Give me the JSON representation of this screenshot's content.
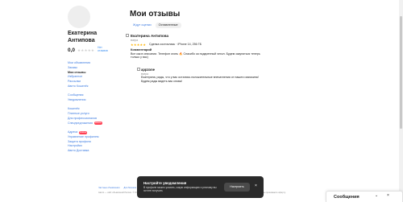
{
  "profile": {
    "name": "Екатерина Антипова",
    "rating": "0,0",
    "stars": "★★★★★",
    "no_reviews": "Нет отзывов"
  },
  "nav": {
    "group1": [
      "Мои объявления",
      "Заказы",
      "Мои отзывы",
      "Избранное",
      "Рассылки",
      "Авито Кошелёк"
    ],
    "group2": [
      "Сообщения",
      "Уведомления"
    ],
    "group3": [
      "Кошелёк",
      "Платные услуги",
      "Для профессионалов",
      "Спецпредложения"
    ],
    "group4": [
      "Адреса",
      "Управление профилем",
      "Защита профиля",
      "Настройки",
      "Авито Доставка"
    ],
    "badge_new": "Новое",
    "active": "Мои отзывы"
  },
  "main": {
    "title": "Мои отзывы",
    "tabs": [
      "Ждут оценки",
      "Оставленные"
    ]
  },
  "review": {
    "author": "Екатерина Антипова",
    "date": "вчера",
    "stars": "★★★★★",
    "deal": "Сделка состоялась · iPhone 14, 256 ГБ",
    "comment_label": "Комментарий",
    "comment": "Все как в описании. Телефон огонь 🔥 Спасибо за подаренный чехол. Будем закупаться теперь только у вас)"
  },
  "reply": {
    "author": "appzone",
    "date": "вчера",
    "text": "Екатерина, рады, что у вас остались положительные впечатления от нашего магазина! Будем рады видеть вас снова!"
  },
  "footer": {
    "links": [
      "Частные объявления",
      "Для бизнеса",
      "Реклама на сайте",
      "Помощь",
      "Безопасность",
      "Блог Авито",
      "Мобильное приложение"
    ],
    "copyright": "Авито — сайт объявлений России. © ООО «КЕХ еКоммерц» 2007–2024. Условия использования Авито. Политика о данных пользователей. Оплачивая услуги на Авито, вы принимаете оферту."
  },
  "popup": {
    "title": "Настройте уведомления",
    "text": "В профиле можно указать, какую информацию и рекламу вы хотите получать",
    "button": "Настроить",
    "close": "×"
  },
  "messages": {
    "title": "Сообщения",
    "collapse": "⌄",
    "close": "×"
  }
}
